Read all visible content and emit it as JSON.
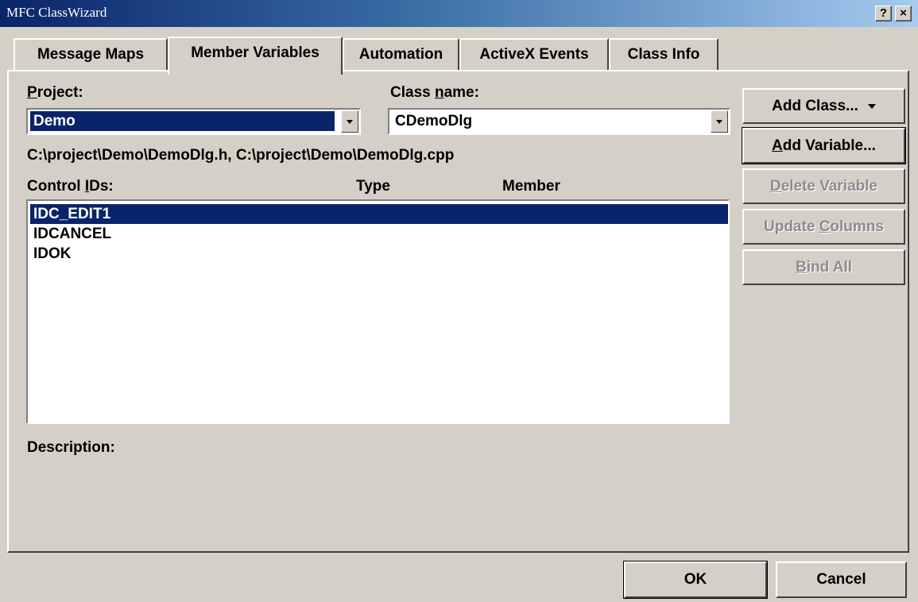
{
  "window": {
    "title": "MFC ClassWizard",
    "help_label": "?",
    "close_label": "×"
  },
  "tabs": [
    {
      "label": "Message Maps",
      "active": false
    },
    {
      "label": "Member Variables",
      "active": true
    },
    {
      "label": "Automation",
      "active": false
    },
    {
      "label": "ActiveX Events",
      "active": false
    },
    {
      "label": "Class Info",
      "active": false
    }
  ],
  "project": {
    "label_accel": "P",
    "label_rest": "roject:",
    "value": "Demo"
  },
  "class_name": {
    "label_pre": "Class ",
    "label_accel": "n",
    "label_rest": "ame:",
    "value": "CDemoDlg"
  },
  "file_path": "C:\\project\\Demo\\DemoDlg.h, C:\\project\\Demo\\DemoDlg.cpp",
  "list": {
    "col_control_pre": "Control ",
    "col_control_accel": "I",
    "col_control_rest": "Ds:",
    "col_type": "Type",
    "col_member": "Member",
    "rows": [
      {
        "id": "IDC_EDIT1",
        "selected": true
      },
      {
        "id": "IDCANCEL",
        "selected": false
      },
      {
        "id": "IDOK",
        "selected": false
      }
    ]
  },
  "description_label": "Description:",
  "side_buttons": {
    "add_class": "Add Class...",
    "add_variable_accel": "A",
    "add_variable_rest": "dd Variable...",
    "delete_variable_accel": "D",
    "delete_variable_rest": "elete Variable",
    "update_columns_pre": "Update ",
    "update_columns_accel": "C",
    "update_columns_rest": "olumns",
    "bind_all_accel": "B",
    "bind_all_rest": "ind All"
  },
  "footer": {
    "ok_label": "OK",
    "cancel_label": "Cancel"
  },
  "colors": {
    "face": "#d4d0c8",
    "selection": "#0a246a",
    "title_gradient_start": "#0a246a",
    "title_gradient_end": "#a6caf0"
  }
}
